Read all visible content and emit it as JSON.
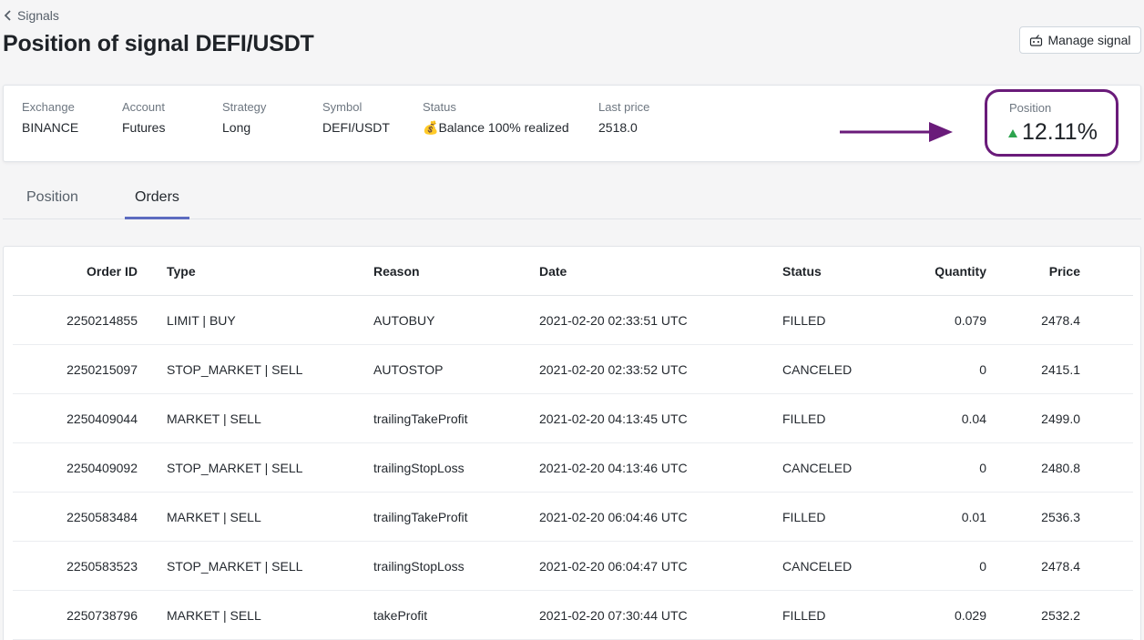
{
  "header": {
    "back_label": "Signals",
    "title": "Position of signal DEFI/USDT",
    "manage_label": "Manage signal"
  },
  "summary": {
    "fields": [
      {
        "label": "Exchange",
        "value": "BINANCE"
      },
      {
        "label": "Account",
        "value": "Futures"
      },
      {
        "label": "Strategy",
        "value": "Long"
      },
      {
        "label": "Symbol",
        "value": "DEFI/USDT"
      },
      {
        "label": "Status",
        "icon": "💰",
        "value": "Balance 100% realized"
      },
      {
        "label": "Last price",
        "value": "2518.0"
      }
    ],
    "position": {
      "label": "Position",
      "value": "12.11%",
      "trend": "up"
    }
  },
  "colors": {
    "highlight": "#6a1b7a",
    "up": "#2da44e",
    "tab_active": "#5c6bc0"
  },
  "tabs": [
    {
      "label": "Position",
      "active": false
    },
    {
      "label": "Orders",
      "active": true
    }
  ],
  "table": {
    "columns": [
      "Order ID",
      "Type",
      "Reason",
      "Date",
      "Status",
      "Quantity",
      "Price"
    ],
    "rows": [
      [
        "2250214855",
        "LIMIT | BUY",
        "AUTOBUY",
        "2021-02-20 02:33:51 UTC",
        "FILLED",
        "0.079",
        "2478.4"
      ],
      [
        "2250215097",
        "STOP_MARKET | SELL",
        "AUTOSTOP",
        "2021-02-20 02:33:52 UTC",
        "CANCELED",
        "0",
        "2415.1"
      ],
      [
        "2250409044",
        "MARKET | SELL",
        "trailingTakeProfit",
        "2021-02-20 04:13:45 UTC",
        "FILLED",
        "0.04",
        "2499.0"
      ],
      [
        "2250409092",
        "STOP_MARKET | SELL",
        "trailingStopLoss",
        "2021-02-20 04:13:46 UTC",
        "CANCELED",
        "0",
        "2480.8"
      ],
      [
        "2250583484",
        "MARKET | SELL",
        "trailingTakeProfit",
        "2021-02-20 06:04:46 UTC",
        "FILLED",
        "0.01",
        "2536.3"
      ],
      [
        "2250583523",
        "STOP_MARKET | SELL",
        "trailingStopLoss",
        "2021-02-20 06:04:47 UTC",
        "CANCELED",
        "0",
        "2478.4"
      ],
      [
        "2250738796",
        "MARKET | SELL",
        "takeProfit",
        "2021-02-20 07:30:44 UTC",
        "FILLED",
        "0.029",
        "2532.2"
      ]
    ]
  }
}
